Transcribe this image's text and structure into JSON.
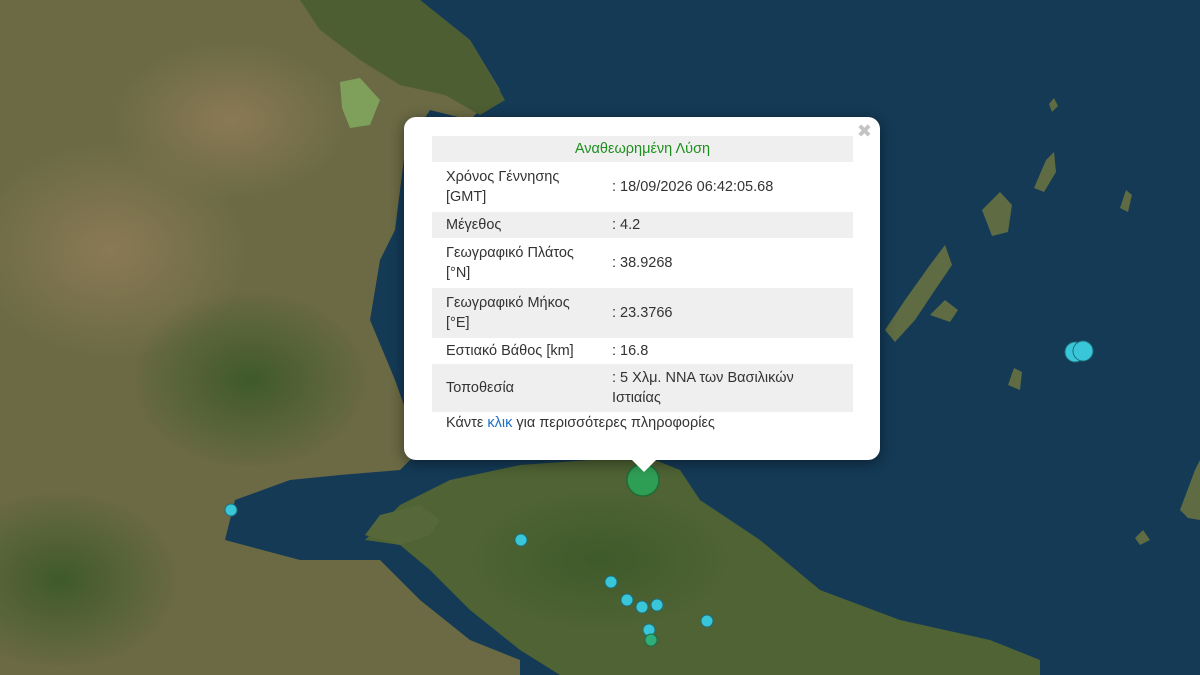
{
  "popup": {
    "header": "Αναθεωρημένη Λύση",
    "close_icon": "close-icon",
    "rows": [
      {
        "label": "Χρόνος Γέννησης [GMT]",
        "value": ": 18/09/2026 06:42:05.68"
      },
      {
        "label": "Μέγεθος",
        "value": ": 4.2"
      },
      {
        "label": "Γεωγραφικό Πλάτος [°N]",
        "value": ": 38.9268"
      },
      {
        "label": "Γεωγραφικό Μήκος [°E]",
        "value": ": 23.3766"
      },
      {
        "label": "Εστιακό Βάθος [km]",
        "value": ": 16.8"
      },
      {
        "label": "Τοποθεσία",
        "value": ": 5 Χλμ. ΝΝΑ των Βασιλικών Ιστιαίας"
      }
    ],
    "more_prefix": "Κάντε ",
    "more_link": "κλικ",
    "more_suffix": " για περισσότερες πληροφορίες"
  },
  "colors": {
    "sea": "#123a57",
    "land": "#5f6d3e",
    "selected_marker": "#2f9e55",
    "marker": "#39c6d8",
    "header_text": "#1e8f1e",
    "link": "#1f6fc5"
  }
}
